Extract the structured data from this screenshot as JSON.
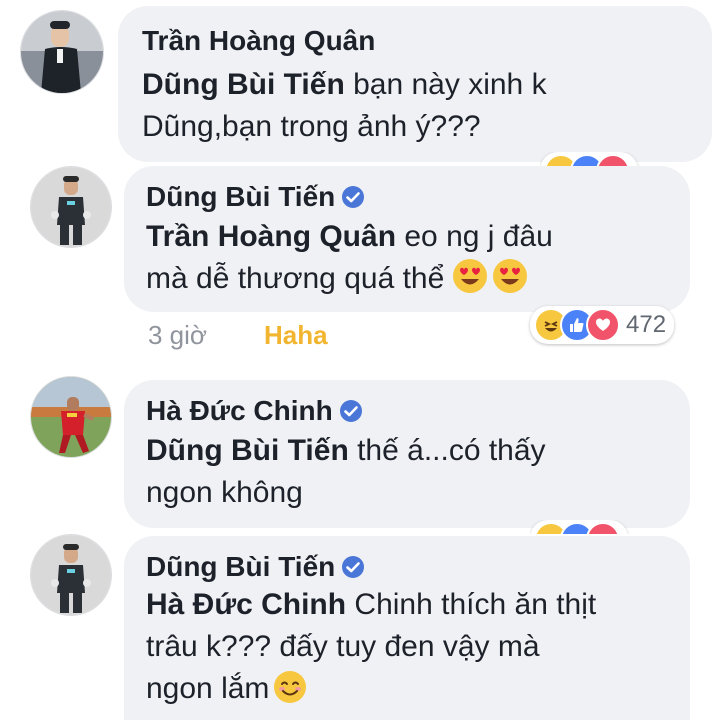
{
  "colors": {
    "bubble": "#f0f1f5",
    "text": "#1d2129",
    "meta": "#90949c",
    "haha": "#f2b52f",
    "verified": "#4a76d8",
    "like": "#4c82f7",
    "love": "#f0536a",
    "haha_face": "#f7c83f"
  },
  "comments": [
    {
      "author": "Trần Hoàng Quân",
      "verified": false,
      "avatar": "man-in-suit-photo",
      "tag": "Dũng Bùi Tiến",
      "line1_rest": " bạn này xinh k",
      "line2": "Dũng,bạn trong ảnh ý???",
      "reactions": [
        "haha-icon",
        "like-icon",
        "love-icon"
      ]
    },
    {
      "author": "Dũng Bùi Tiến",
      "verified": true,
      "avatar": "goalkeeper-photo",
      "tag": "Trần Hoàng Quân",
      "line1_rest": " eo ng j đâu",
      "line2": "mà dễ thương quá thể",
      "emojis": [
        "heart-eyes-emoji",
        "heart-eyes-emoji"
      ],
      "time": "3 giờ",
      "reaction_label": "Haha",
      "reaction_count": "472"
    },
    {
      "author": "Hà Đức Chinh",
      "verified": true,
      "avatar": "footballer-photo",
      "tag": "Dũng Bùi Tiến",
      "line1_rest": " thế á...có thấy",
      "line2": "ngon không"
    },
    {
      "author": "Dũng Bùi Tiến",
      "verified": true,
      "avatar": "goalkeeper-photo",
      "tag": "Hà Đức Chinh",
      "line1_rest": "  Chinh thích ăn thịt",
      "line2": "trâu k??? đấy tuy đen vậy mà",
      "line3": "ngon lắm",
      "emojis": [
        "smiling-face-emoji"
      ]
    }
  ]
}
